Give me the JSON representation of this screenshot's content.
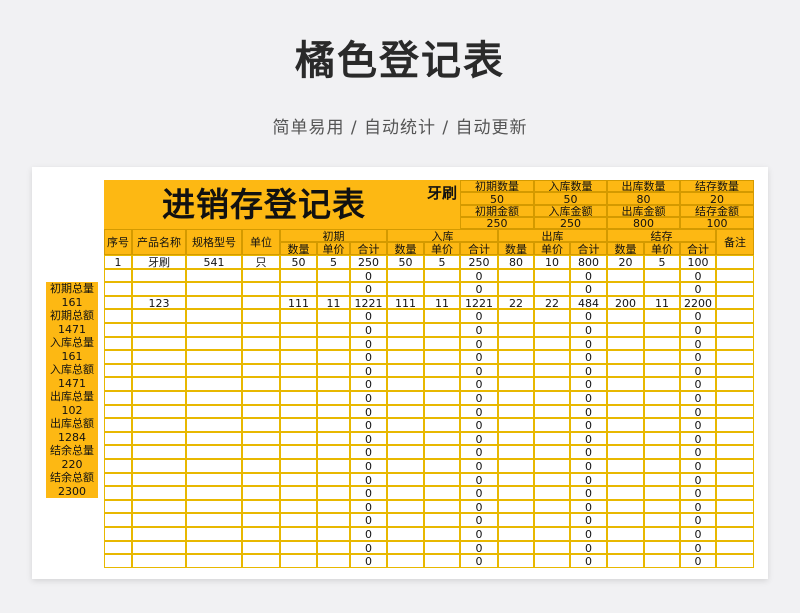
{
  "page": {
    "title": "橘色登记表",
    "subtitle": "简单易用 / 自动统计 / 自动更新"
  },
  "sheet": {
    "title": "进销存登记表",
    "product_label": "牙刷",
    "summary": [
      {
        "label": "初期数量",
        "value": "50"
      },
      {
        "label": "入库数量",
        "value": "50"
      },
      {
        "label": "出库数量",
        "value": "80"
      },
      {
        "label": "结存数量",
        "value": "20"
      },
      {
        "label": "初期金额",
        "value": "250"
      },
      {
        "label": "入库金额",
        "value": "250"
      },
      {
        "label": "出库金额",
        "value": "800"
      },
      {
        "label": "结存金额",
        "value": "100"
      }
    ],
    "headers": {
      "fixed": [
        "序号",
        "产品名称",
        "规格型号",
        "单位"
      ],
      "groups": [
        "初期",
        "入库",
        "出库",
        "结存"
      ],
      "sub": [
        "数量",
        "单价",
        "合计"
      ],
      "remark": "备注"
    },
    "rows": [
      [
        "1",
        "牙刷",
        "541",
        "只",
        "50",
        "5",
        "250",
        "50",
        "5",
        "250",
        "80",
        "10",
        "800",
        "20",
        "5",
        "100",
        ""
      ],
      [
        "",
        "",
        "",
        "",
        "",
        "",
        "0",
        "",
        "",
        "0",
        "",
        "",
        "0",
        "",
        "",
        "0",
        ""
      ],
      [
        "",
        "",
        "",
        "",
        "",
        "",
        "0",
        "",
        "",
        "0",
        "",
        "",
        "0",
        "",
        "",
        "0",
        ""
      ],
      [
        "",
        "123",
        "",
        "",
        "111",
        "11",
        "1221",
        "111",
        "11",
        "1221",
        "22",
        "22",
        "484",
        "200",
        "11",
        "2200",
        ""
      ],
      [
        "",
        "",
        "",
        "",
        "",
        "",
        "0",
        "",
        "",
        "0",
        "",
        "",
        "0",
        "",
        "",
        "0",
        ""
      ],
      [
        "",
        "",
        "",
        "",
        "",
        "",
        "0",
        "",
        "",
        "0",
        "",
        "",
        "0",
        "",
        "",
        "0",
        ""
      ],
      [
        "",
        "",
        "",
        "",
        "",
        "",
        "0",
        "",
        "",
        "0",
        "",
        "",
        "0",
        "",
        "",
        "0",
        ""
      ],
      [
        "",
        "",
        "",
        "",
        "",
        "",
        "0",
        "",
        "",
        "0",
        "",
        "",
        "0",
        "",
        "",
        "0",
        ""
      ],
      [
        "",
        "",
        "",
        "",
        "",
        "",
        "0",
        "",
        "",
        "0",
        "",
        "",
        "0",
        "",
        "",
        "0",
        ""
      ],
      [
        "",
        "",
        "",
        "",
        "",
        "",
        "0",
        "",
        "",
        "0",
        "",
        "",
        "0",
        "",
        "",
        "0",
        ""
      ],
      [
        "",
        "",
        "",
        "",
        "",
        "",
        "0",
        "",
        "",
        "0",
        "",
        "",
        "0",
        "",
        "",
        "0",
        ""
      ],
      [
        "",
        "",
        "",
        "",
        "",
        "",
        "0",
        "",
        "",
        "0",
        "",
        "",
        "0",
        "",
        "",
        "0",
        ""
      ],
      [
        "",
        "",
        "",
        "",
        "",
        "",
        "0",
        "",
        "",
        "0",
        "",
        "",
        "0",
        "",
        "",
        "0",
        ""
      ],
      [
        "",
        "",
        "",
        "",
        "",
        "",
        "0",
        "",
        "",
        "0",
        "",
        "",
        "0",
        "",
        "",
        "0",
        ""
      ],
      [
        "",
        "",
        "",
        "",
        "",
        "",
        "0",
        "",
        "",
        "0",
        "",
        "",
        "0",
        "",
        "",
        "0",
        ""
      ],
      [
        "",
        "",
        "",
        "",
        "",
        "",
        "0",
        "",
        "",
        "0",
        "",
        "",
        "0",
        "",
        "",
        "0",
        ""
      ],
      [
        "",
        "",
        "",
        "",
        "",
        "",
        "0",
        "",
        "",
        "0",
        "",
        "",
        "0",
        "",
        "",
        "0",
        ""
      ],
      [
        "",
        "",
        "",
        "",
        "",
        "",
        "0",
        "",
        "",
        "0",
        "",
        "",
        "0",
        "",
        "",
        "0",
        ""
      ],
      [
        "",
        "",
        "",
        "",
        "",
        "",
        "0",
        "",
        "",
        "0",
        "",
        "",
        "0",
        "",
        "",
        "0",
        ""
      ],
      [
        "",
        "",
        "",
        "",
        "",
        "",
        "0",
        "",
        "",
        "0",
        "",
        "",
        "0",
        "",
        "",
        "0",
        ""
      ],
      [
        "",
        "",
        "",
        "",
        "",
        "",
        "0",
        "",
        "",
        "0",
        "",
        "",
        "0",
        "",
        "",
        "0",
        ""
      ],
      [
        "",
        "",
        "",
        "",
        "",
        "",
        "0",
        "",
        "",
        "0",
        "",
        "",
        "0",
        "",
        "",
        "0",
        ""
      ],
      [
        "",
        "",
        "",
        "",
        "",
        "",
        "0",
        "",
        "",
        "0",
        "",
        "",
        "0",
        "",
        "",
        "0",
        ""
      ]
    ],
    "side_totals": [
      {
        "label": "初期总量",
        "value": "161"
      },
      {
        "label": "初期总额",
        "value": "1471"
      },
      {
        "label": "入库总量",
        "value": "161"
      },
      {
        "label": "入库总额",
        "value": "1471"
      },
      {
        "label": "出库总量",
        "value": "102"
      },
      {
        "label": "出库总额",
        "value": "1284"
      },
      {
        "label": "结余总量",
        "value": "220"
      },
      {
        "label": "结余总额",
        "value": "2300"
      }
    ],
    "colors": {
      "accent": "#fdb813",
      "grid": "#e8b800",
      "text": "#111111"
    }
  }
}
